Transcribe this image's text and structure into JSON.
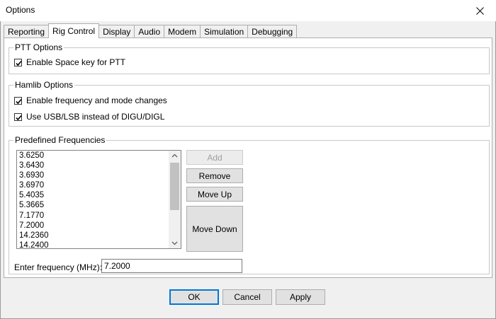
{
  "window": {
    "title": "Options"
  },
  "tabs": [
    "Reporting",
    "Rig Control",
    "Display",
    "Audio",
    "Modem",
    "Simulation",
    "Debugging"
  ],
  "active_tab": "Rig Control",
  "ptt": {
    "title": "PTT Options",
    "space_key": {
      "label": "Enable Space key for PTT",
      "checked": true
    }
  },
  "hamlib": {
    "title": "Hamlib Options",
    "freq_mode": {
      "label": "Enable frequency and mode changes",
      "checked": true
    },
    "usb_lsb": {
      "label": "Use USB/LSB instead of DIGU/DIGL",
      "checked": true
    }
  },
  "predefined": {
    "title": "Predefined Frequencies",
    "items": [
      "3.6250",
      "3.6430",
      "3.6930",
      "3.6970",
      "5.4035",
      "5.3665",
      "7.1770",
      "7.2000",
      "14.2360",
      "14.2400"
    ],
    "buttons": {
      "add": "Add",
      "remove": "Remove",
      "move_up": "Move Up",
      "move_down": "Move Down"
    },
    "enter_label": "Enter frequency (MHz):",
    "enter_value": "7.2000"
  },
  "footer": {
    "ok": "OK",
    "cancel": "Cancel",
    "apply": "Apply"
  },
  "colors": {
    "accent": "#0078d7"
  }
}
